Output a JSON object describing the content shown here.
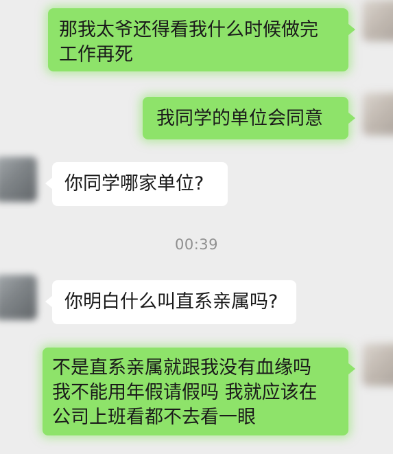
{
  "messages": [
    {
      "direction": "outgoing",
      "lines": [
        "那我太爷还得看我什么时候做完",
        "工作再死"
      ]
    },
    {
      "direction": "outgoing",
      "lines": [
        "我同学的单位会同意"
      ]
    },
    {
      "direction": "incoming",
      "lines": [
        "你同学哪家单位?"
      ]
    },
    {
      "direction": "incoming",
      "lines": [
        "你明白什么叫直系亲属吗?"
      ]
    },
    {
      "direction": "outgoing",
      "lines": [
        "不是直系亲属就跟我没有血缘吗",
        "我不能用年假请假吗 我就应该在",
        "公司上班看都不去看一眼"
      ]
    }
  ],
  "timestamp": "00:39",
  "colors": {
    "background": "#ededed",
    "outgoing_bubble": "#8ee36a",
    "incoming_bubble": "#ffffff",
    "timestamp_text": "#8f8f8f"
  }
}
